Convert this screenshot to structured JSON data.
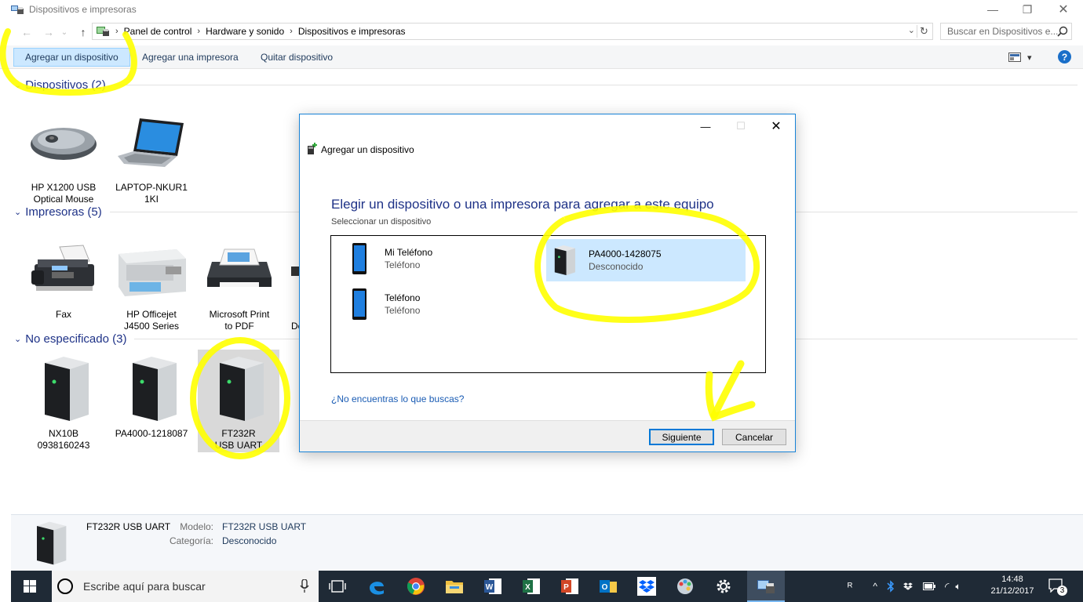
{
  "window": {
    "title": "Dispositivos e impresoras",
    "minimize": "—",
    "restore": "❐",
    "close": "✕"
  },
  "nav": {
    "back": "←",
    "forward": "→",
    "recent": "⌄",
    "up": "↑",
    "breadcrumb": [
      "Panel de control",
      "Hardware y sonido",
      "Dispositivos e impresoras"
    ],
    "crumb_separator": "›",
    "dropdown": "⌄",
    "refresh": "↻",
    "search_placeholder": "Buscar en Dispositivos e..."
  },
  "toolbar": {
    "add_device": "Agregar un dispositivo",
    "add_printer": "Agregar una impresora",
    "remove_device": "Quitar dispositivo",
    "view_dropdown": "▾",
    "help": "?"
  },
  "groups": {
    "devices": {
      "title": "Dispositivos (2)",
      "chevron": "⌄",
      "items": [
        {
          "label": "HP X1200 USB Optical Mouse",
          "icon": "mouse-icon"
        },
        {
          "label": "LAPTOP-NKUR11KI",
          "icon": "laptop-icon"
        }
      ]
    },
    "printers": {
      "title": "Impresoras (5)",
      "chevron": "⌄",
      "items": [
        {
          "label": "Fax",
          "icon": "fax-icon"
        },
        {
          "label": "HP Officejet J4500 Series",
          "icon": "printer-icon"
        },
        {
          "label": "Microsoft Print to PDF",
          "icon": "printer-icon"
        },
        {
          "label": "De",
          "icon": "printer-icon"
        }
      ]
    },
    "unspecified": {
      "title": "No especificado (3)",
      "chevron": "⌄",
      "items": [
        {
          "label": "NX10B 0938160243",
          "icon": "generic-device-icon"
        },
        {
          "label": "PA4000-1218087",
          "icon": "generic-device-icon"
        },
        {
          "label": "FT232R USB UART",
          "icon": "generic-device-icon",
          "selected": true
        }
      ]
    }
  },
  "details": {
    "name": "FT232R USB UART",
    "model_label": "Modelo:",
    "model_value": "FT232R USB UART",
    "category_label": "Categoría:",
    "category_value": "Desconocido"
  },
  "dialog": {
    "title": "Agregar un dispositivo",
    "minimize": "—",
    "maximize": "☐",
    "close": "✕",
    "heading": "Elegir un dispositivo o una impresora para agregar a este equipo",
    "subheading": "Seleccionar un dispositivo",
    "items": [
      {
        "name": "Mi Teléfono",
        "type": "Teléfono",
        "icon": "phone-icon"
      },
      {
        "name": "PA4000-1428075",
        "type": "Desconocido",
        "icon": "generic-device-icon",
        "selected": true
      },
      {
        "name": "Teléfono",
        "type": "Teléfono",
        "icon": "phone-icon"
      }
    ],
    "help_link": "¿No encuentras lo que buscas?",
    "next_button": "Siguiente",
    "cancel_button": "Cancelar"
  },
  "taskbar": {
    "search_placeholder": "Escribe aquí para buscar",
    "time": "14:48",
    "date": "21/12/2017",
    "notification_count": "3",
    "people_glyph": "ᴿ",
    "chevron_glyph": "^",
    "wifi_glyph": "◜",
    "volume_glyph": "🔈︎"
  },
  "colors": {
    "accent": "#0078d7",
    "group_title": "#1e3287",
    "annotation": "#ffff00",
    "taskbar": "#1f2a36"
  }
}
